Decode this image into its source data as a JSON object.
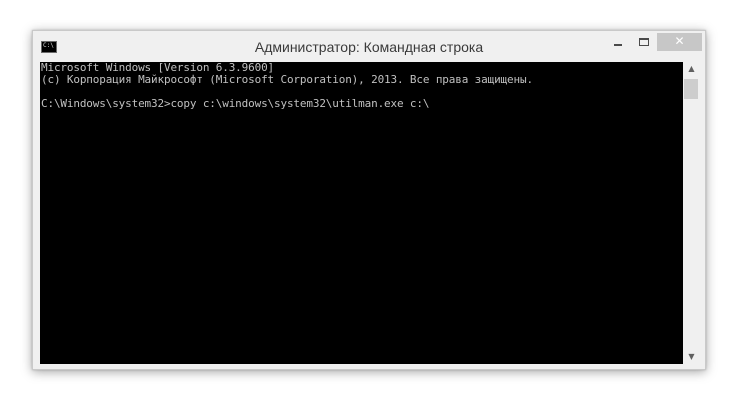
{
  "window": {
    "title": "Администратор: Командная строка",
    "icon": "console-icon",
    "icon_glyph": "C:\\"
  },
  "titlebar_buttons": {
    "minimize_icon": "minimize-icon",
    "maximize_icon": "maximize-icon",
    "close_icon": "close-icon",
    "close_glyph": "✕"
  },
  "console": {
    "lines": [
      "Microsoft Windows [Version 6.3.9600]",
      "(c) Корпорация Майкрософт (Microsoft Corporation), 2013. Все права защищены.",
      "",
      "C:\\Windows\\system32>copy c:\\windows\\system32\\utilman.exe c:\\"
    ],
    "background_color": "#000000",
    "text_color": "#c0c0c0"
  },
  "scrollbar": {
    "up_glyph": "▲",
    "down_glyph": "▼"
  }
}
